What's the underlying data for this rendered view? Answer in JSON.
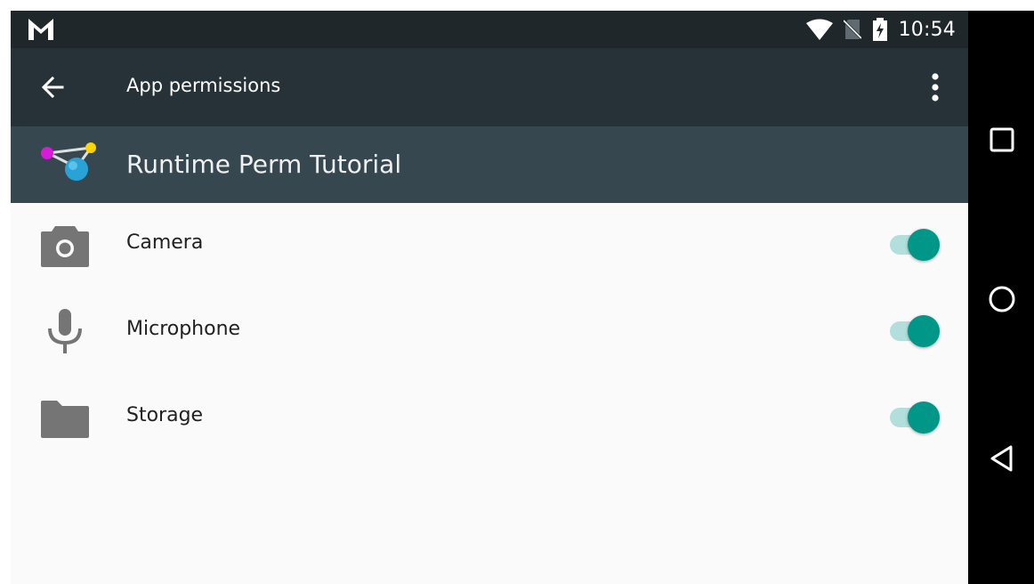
{
  "status_bar": {
    "time": "10:54",
    "icons": [
      "gmail-icon",
      "wifi-icon",
      "no-sim-icon",
      "battery-charging-icon"
    ]
  },
  "app_bar": {
    "title": "App permissions",
    "icons": [
      "back-arrow-icon",
      "more-vert-icon"
    ]
  },
  "app_header": {
    "app_name": "Runtime Perm Tutorial",
    "icon": "molecule-app-icon"
  },
  "permissions": [
    {
      "label": "Camera",
      "icon": "camera-icon",
      "enabled": true
    },
    {
      "label": "Microphone",
      "icon": "microphone-icon",
      "enabled": true
    },
    {
      "label": "Storage",
      "icon": "folder-icon",
      "enabled": true
    }
  ],
  "nav_bar": {
    "icons": [
      "recents-square-icon",
      "home-circle-icon",
      "back-triangle-icon"
    ]
  },
  "colors": {
    "status_bar": "#1f272b",
    "app_bar": "#263238",
    "app_header": "#37474f",
    "list_background": "#fafafa",
    "toggle_thumb": "#009688",
    "toggle_track": "#b2dfdb",
    "icon_gray": "#757575"
  }
}
